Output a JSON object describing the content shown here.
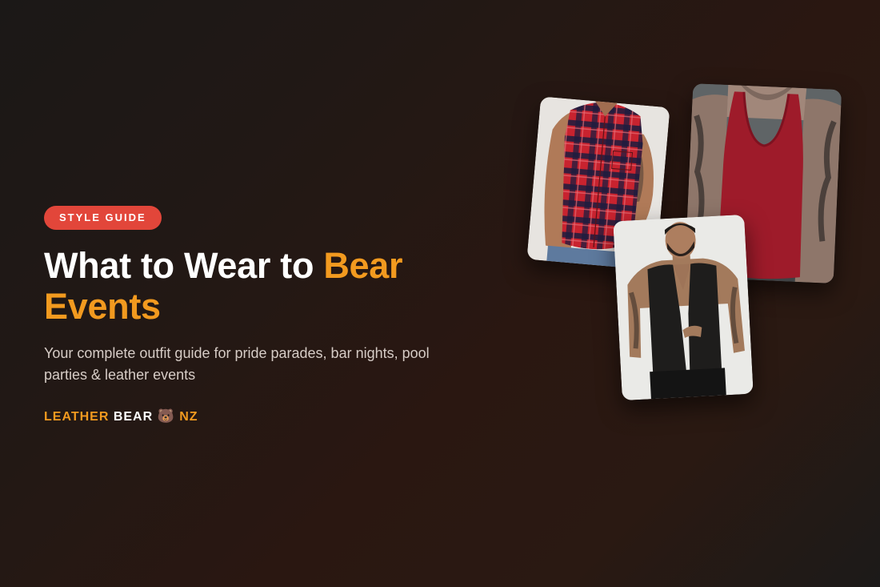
{
  "hero": {
    "badge": "STYLE GUIDE",
    "title_part1": "What to Wear to ",
    "title_accent": "Bear Events",
    "subtitle": "Your complete outfit guide for pride parades, bar nights, pool parties & leather events",
    "brand": {
      "part1": "LEATHER",
      "part2": "BEAR",
      "emoji": "🐻",
      "part3": "NZ"
    }
  },
  "colors": {
    "badge_background": "#e2463a",
    "accent": "#f29a1f",
    "title": "#ffffff",
    "subtitle": "#d6ccc6"
  },
  "images": [
    {
      "name": "plaid-shirt-photo",
      "subject": "man in red and navy plaid sleeveless shirt"
    },
    {
      "name": "red-tank-photo",
      "subject": "tattooed man in red tank top"
    },
    {
      "name": "leather-vest-photo",
      "subject": "tattooed man in black leather vest"
    }
  ]
}
